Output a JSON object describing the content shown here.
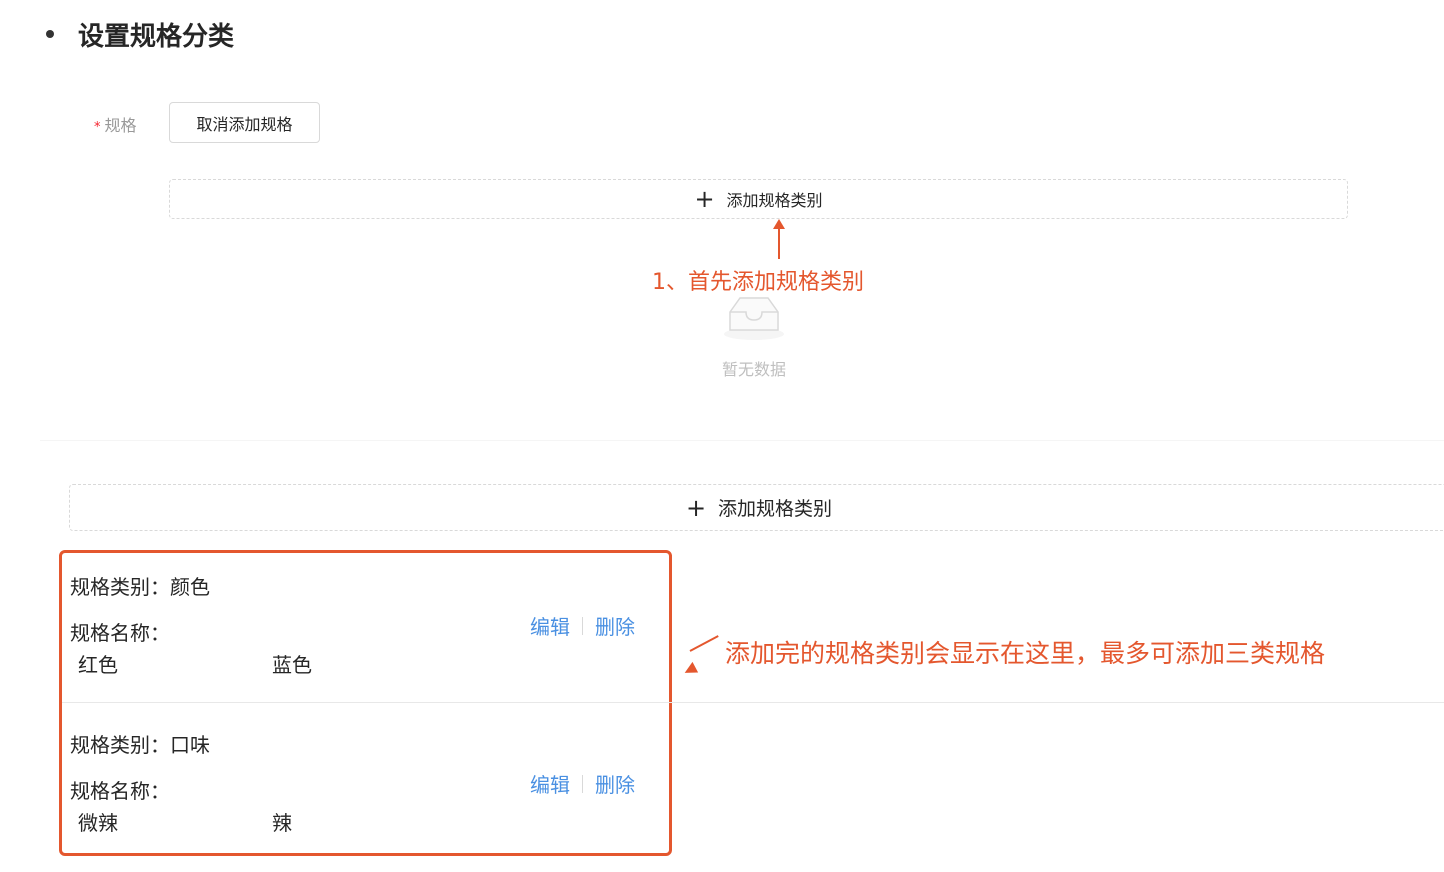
{
  "section": {
    "title": "设置规格分类"
  },
  "spec": {
    "label": "规格",
    "required_mark": "*",
    "cancel_button": "取消添加规格"
  },
  "add_category": {
    "plus": "+",
    "label": "添加规格类别"
  },
  "annotations": {
    "first": "1、首先添加规格类别",
    "second": "添加完的规格类别会显示在这里，最多可添加三类规格"
  },
  "empty": {
    "text": "暂无数据"
  },
  "spec_rows": [
    {
      "category_label": "规格类别：",
      "category": "颜色",
      "names_label": "规格名称：",
      "names": [
        "红色",
        "蓝色"
      ],
      "edit": "编辑",
      "delete": "删除"
    },
    {
      "category_label": "规格类别：",
      "category": "口味",
      "names_label": "规格名称：",
      "names": [
        "微辣",
        "辣"
      ],
      "edit": "编辑",
      "delete": "删除"
    }
  ],
  "colors": {
    "annotation": "#e4572e",
    "link": "#4a90e2",
    "required": "#f5222d"
  }
}
